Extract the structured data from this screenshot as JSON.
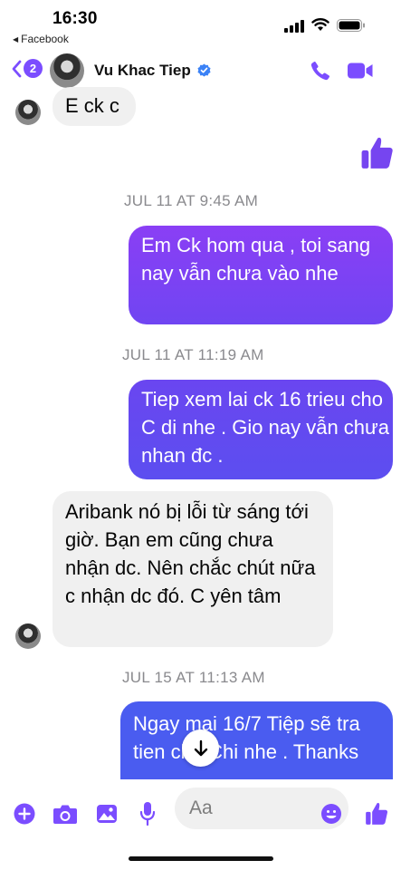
{
  "status_bar": {
    "time": "16:30",
    "back_app": "Facebook"
  },
  "header": {
    "back_count": "2",
    "contact_name": "Vu Khac Tiep"
  },
  "messages": [
    {
      "text": "E ck c"
    },
    {
      "text": "Em Ck hom qua , toi sang nay vẫn chưa vào nhe"
    },
    {
      "text": "Tiep xem lai ck 16 trieu cho C di nhe . Gio nay vẫn chưa nhan đc ."
    },
    {
      "text": "Aribank nó bị lỗi từ sáng tới giờ. Bạn em cũng chưa nhận dc. Nên chắc chút nữa c nhận dc đó. C yên tâm"
    },
    {
      "text": "Ngay mai 16/7 Tiệp sẽ tra tien cho Chi nhe . Thanks"
    }
  ],
  "timestamps": [
    "JUL 11 AT 9:45 AM",
    "JUL 11 AT 11:19 AM",
    "JUL 15 AT 11:13 AM"
  ],
  "composer": {
    "placeholder": "Aa"
  },
  "colors": {
    "accent": "#7b4dff",
    "bubble_purple": "#7645f0",
    "bubble_blue": "#4a5cf0",
    "incoming_bubble": "#f0f0f0"
  },
  "icons": [
    "plus-icon",
    "camera-icon",
    "image-icon",
    "mic-icon",
    "emoji-icon",
    "thumbs-up-icon",
    "phone-icon",
    "video-icon",
    "verified-icon",
    "arrow-down-icon"
  ]
}
